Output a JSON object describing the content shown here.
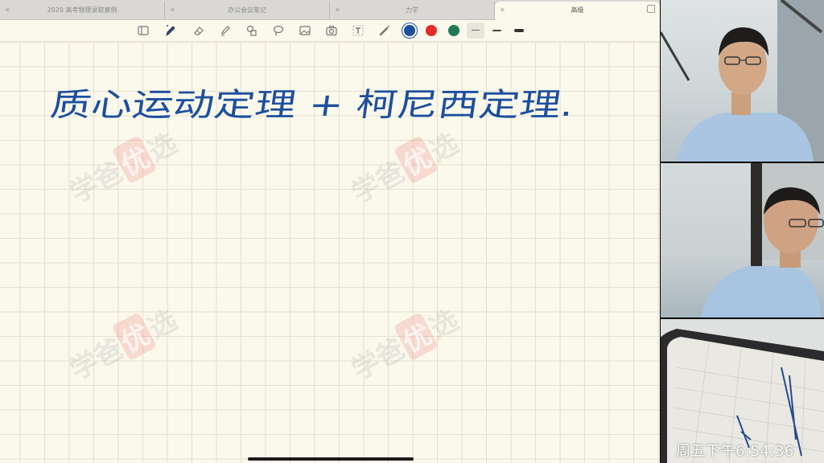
{
  "tabs": [
    {
      "label": "2020 高考物理录取案例",
      "active": false
    },
    {
      "label": "办公会议笔记",
      "active": false
    },
    {
      "label": "力学",
      "active": false
    },
    {
      "label": "高级",
      "active": true
    }
  ],
  "toolbar": {
    "tools": [
      "sidebar-icon",
      "pen-icon",
      "eraser-icon",
      "highlighter-icon",
      "shapes-icon",
      "lasso-icon",
      "image-icon",
      "camera-icon",
      "text-icon",
      "laser-pointer-icon"
    ],
    "selected_tool": "pen-icon",
    "colors": [
      {
        "name": "blue",
        "hex": "#1b4f9f",
        "selected": true
      },
      {
        "name": "red",
        "hex": "#e32a24",
        "selected": false
      },
      {
        "name": "green",
        "hex": "#207a57",
        "selected": false
      }
    ],
    "stroke_widths": [
      "thin",
      "medium",
      "thick"
    ],
    "selected_stroke": "thin"
  },
  "page": {
    "handwritten_text": "质心运动定理 + 柯尼西定理.",
    "ink_color": "#1b4f9f",
    "watermark": {
      "left": "学爸",
      "badge": "优",
      "right": "选"
    }
  },
  "video": {
    "clock": "周五下午6:54:36"
  }
}
